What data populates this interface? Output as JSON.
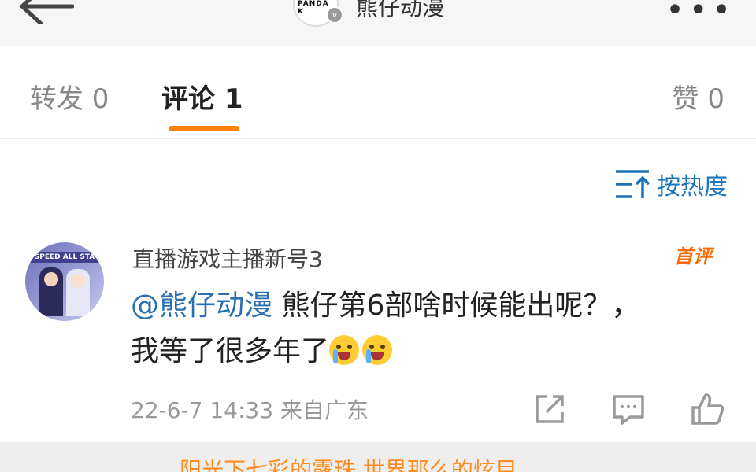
{
  "header": {
    "title": "熊仔动漫",
    "avatar_text": "PANDA K",
    "verified_badge": "v"
  },
  "tabs": [
    {
      "label": "转发 0"
    },
    {
      "label": "评论 1"
    },
    {
      "label": "赞 0"
    }
  ],
  "colors": {
    "accent": "#ff8200",
    "link": "#2a6fb3",
    "muted": "#999999"
  },
  "sort": {
    "label": "按热度"
  },
  "comment": {
    "username": "直播游戏主播新号3",
    "badge": "首评",
    "avatar_banner": "SPEED ALL STA",
    "mention": "@熊仔动漫",
    "text_line1": " 熊仔第6部啥时候能出呢？，",
    "text_line2": "我等了很多年了",
    "meta": "22-6-7 14:33  来自广东"
  },
  "subtitle": "阳光下七彩的露珠 世界那么的炫目"
}
